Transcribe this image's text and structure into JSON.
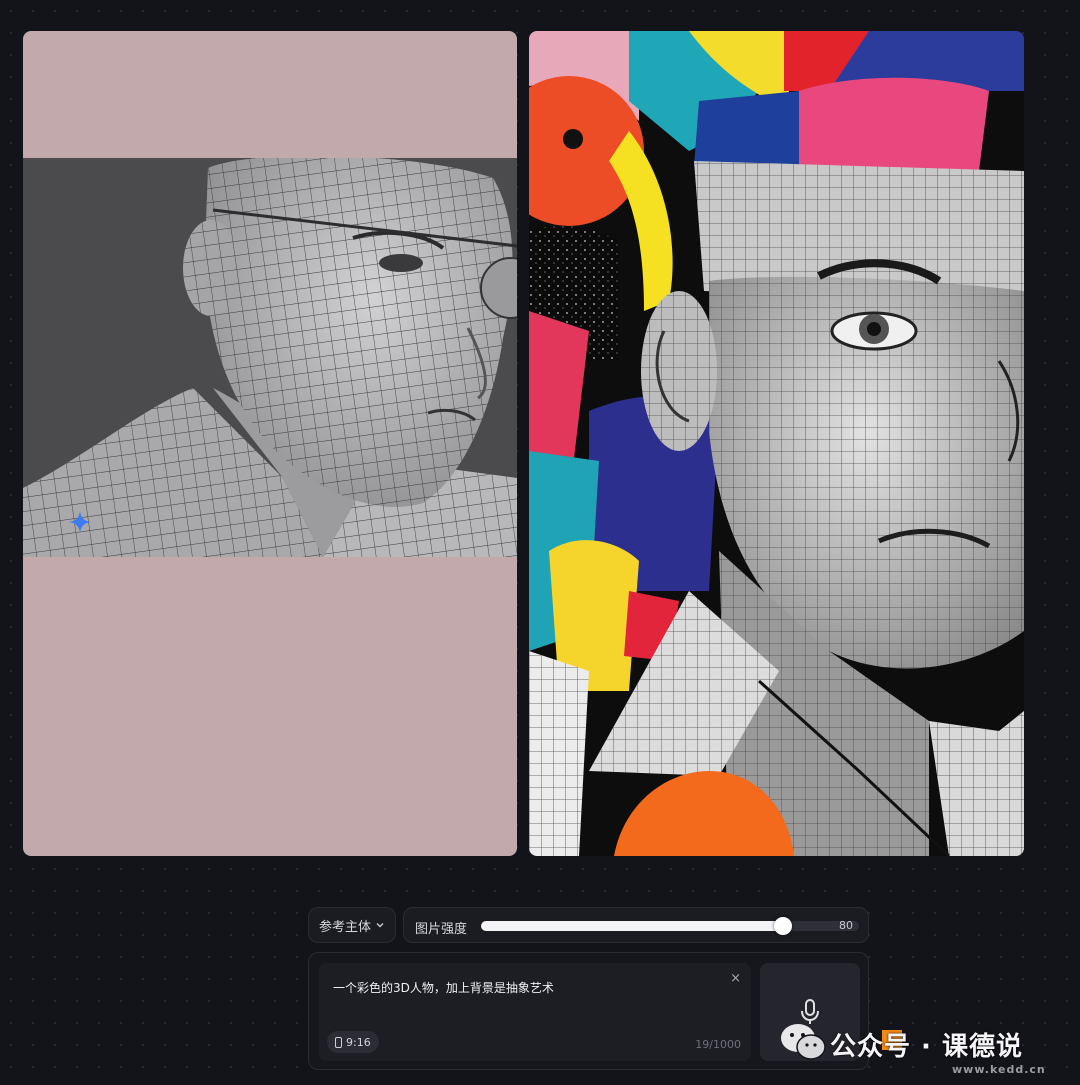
{
  "images": {
    "reference": {
      "sparkle_icon": "sparkle-icon"
    },
    "generated": {}
  },
  "controls": {
    "subject_dropdown": {
      "label": "参考主体",
      "icon": "chevron-down-icon"
    },
    "strength": {
      "label": "图片强度",
      "value": "80",
      "fraction": 0.8
    }
  },
  "prompt": {
    "text": "一个彩色的3D人物，加上背景是抽象艺术",
    "clear_icon": "×",
    "aspect_ratio": "9:16",
    "char_count": "19/1000",
    "mic_icon": "microphone-icon"
  },
  "watermark": {
    "text": "公众号 · 课德说",
    "site": "www.kedd.cn"
  },
  "colors": {
    "background": "#13141a",
    "reference_backdrop": "#c2a9ab",
    "sparkle": "#3d7bf2",
    "slider_fill": "#f4f4f6",
    "watermark_accent": "#f08a14"
  }
}
